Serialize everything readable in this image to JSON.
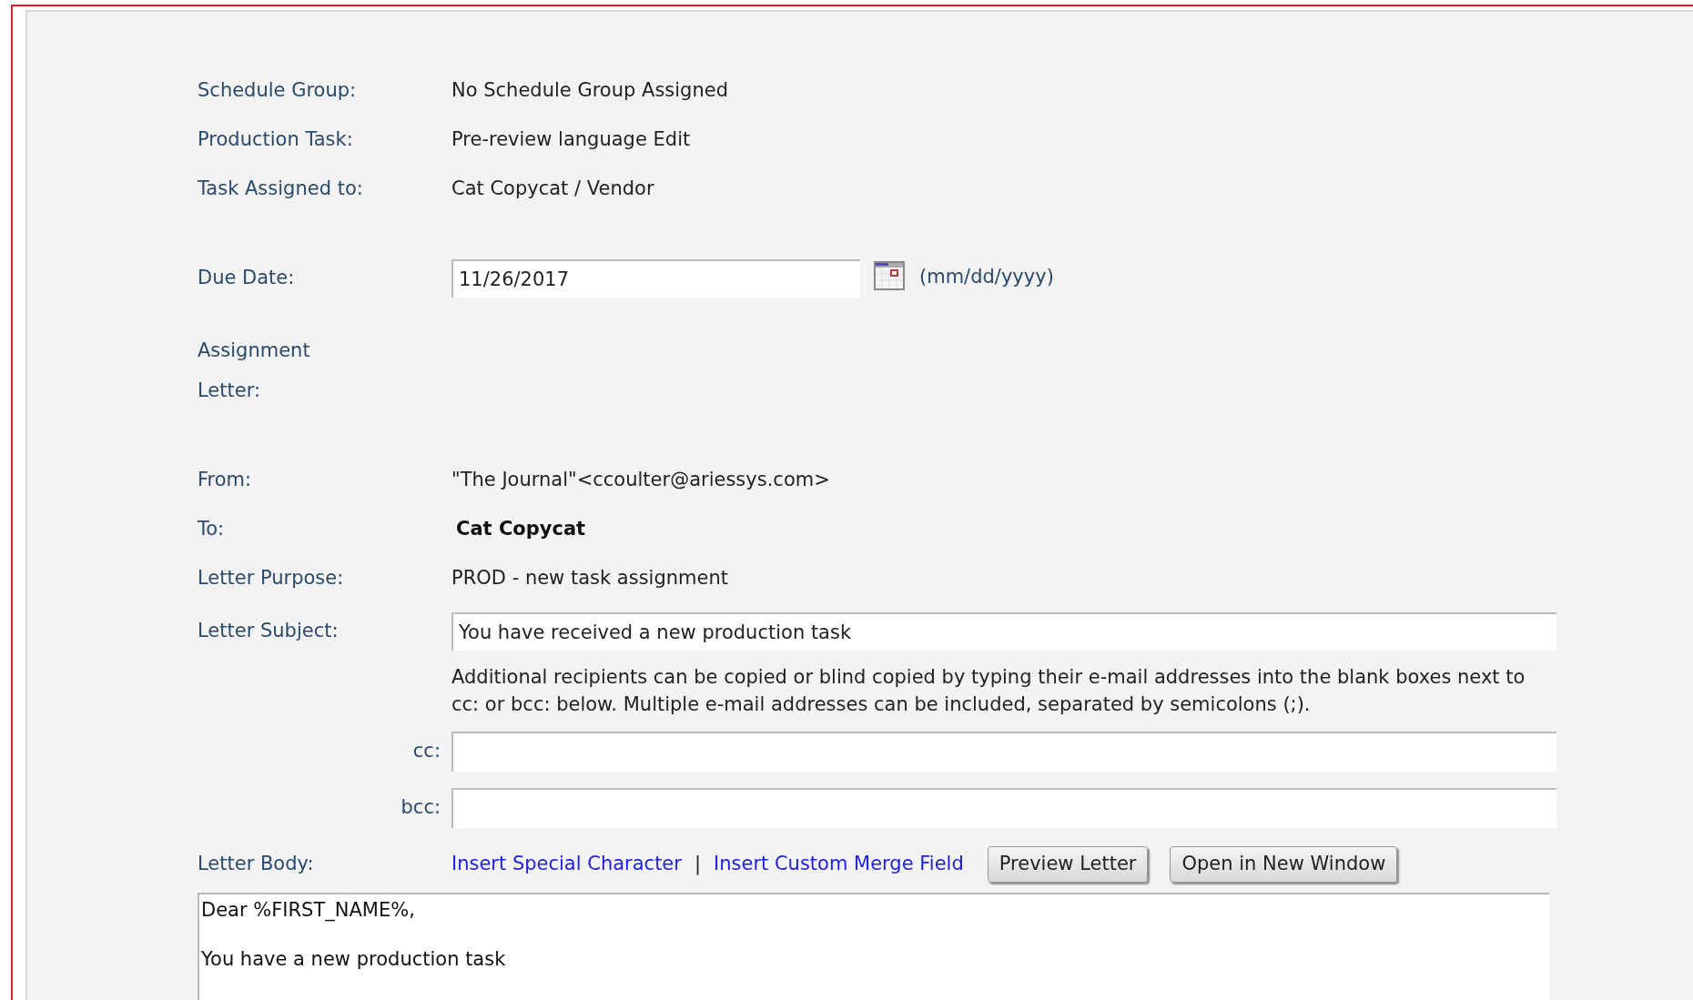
{
  "schedule_group": {
    "label": "Schedule Group:",
    "value": "No Schedule Group Assigned"
  },
  "production_task": {
    "label": "Production Task:",
    "value": "Pre-review language Edit"
  },
  "task_assigned_to": {
    "label": "Task Assigned to:",
    "value": "Cat Copycat / Vendor"
  },
  "due_date": {
    "label": "Due Date:",
    "value": "11/26/2017",
    "format_hint": "(mm/dd/yyyy)"
  },
  "assignment_letter": {
    "label_lines": [
      "Assignment",
      "Letter:"
    ]
  },
  "from": {
    "label": "From:",
    "value": "\"The Journal\"<ccoulter@ariessys.com>"
  },
  "to": {
    "label": "To:",
    "value": "Cat Copycat"
  },
  "letter_purpose": {
    "label": "Letter Purpose:",
    "value": "PROD - new task assignment"
  },
  "letter_subject": {
    "label": "Letter Subject:",
    "value": "You have received a new production task"
  },
  "recipients_note": "Additional recipients can be copied or blind copied by typing their e-mail addresses into the blank boxes next to cc: or bcc: below. Multiple e-mail addresses can be included, separated by semicolons (;).",
  "cc": {
    "label": "cc:"
  },
  "bcc": {
    "label": "bcc:"
  },
  "letter_body": {
    "label": "Letter Body:",
    "links": [
      "Insert Special Character",
      "Insert Custom Merge Field"
    ],
    "separator": "|",
    "buttons": [
      "Preview Letter",
      "Open in New Window"
    ],
    "lines": [
      "Dear %FIRST_NAME%,",
      "You have a new production task"
    ]
  }
}
